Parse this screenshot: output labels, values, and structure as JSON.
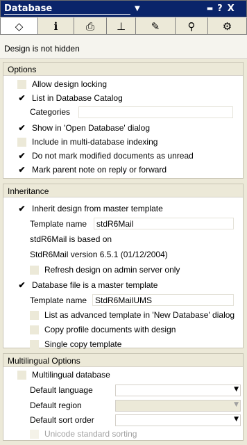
{
  "titlebar": {
    "title": "Database",
    "help": "?",
    "close": "X"
  },
  "tabs": [
    {
      "name": "basics",
      "icon": "basics-icon",
      "glyph": "⬡",
      "active": true
    },
    {
      "name": "info",
      "icon": "info-icon",
      "glyph": "i",
      "active": false
    },
    {
      "name": "print",
      "icon": "printer-icon",
      "glyph": "⎙",
      "active": false
    },
    {
      "name": "design",
      "icon": "design-icon",
      "glyph": "⊥",
      "active": false
    },
    {
      "name": "launch",
      "icon": "pen-icon",
      "glyph": "✎",
      "active": false
    },
    {
      "name": "fulltext",
      "icon": "magnifier-icon",
      "glyph": "⚲",
      "active": false
    },
    {
      "name": "advanced",
      "icon": "advanced-icon",
      "glyph": "⚙",
      "active": false
    }
  ],
  "status_text": "Design is not hidden",
  "options": {
    "header": "Options",
    "allow_locking": {
      "label": "Allow design locking",
      "checked": false
    },
    "list_catalog": {
      "label": "List in Database Catalog",
      "checked": true
    },
    "categories_label": "Categories",
    "categories_value": "",
    "show_open": {
      "label": "Show in 'Open Database' dialog",
      "checked": true
    },
    "multi_index": {
      "label": "Include in multi-database indexing",
      "checked": false
    },
    "no_unread": {
      "label": "Do not mark modified documents as unread",
      "checked": true
    },
    "mark_parent": {
      "label": "Mark parent note on reply or forward",
      "checked": true
    }
  },
  "inheritance": {
    "header": "Inheritance",
    "inherit": {
      "label": "Inherit design from master template",
      "checked": true
    },
    "template_name_label": "Template name",
    "template_name_value": "stdR6Mail",
    "based_on": "stdR6Mail is based on",
    "version": "StdR6Mail version 6.5.1 (01/12/2004)",
    "refresh": {
      "label": "Refresh design on admin server only",
      "checked": false
    },
    "master": {
      "label": "Database file is a master template",
      "checked": true
    },
    "master_name_label": "Template name",
    "master_name_value": "StdR6MailUMS",
    "list_advanced": {
      "label": "List as advanced template in 'New Database' dialog",
      "checked": false
    },
    "copy_profile": {
      "label": "Copy profile documents with design",
      "checked": false
    },
    "single_copy": {
      "label": "Single copy template",
      "checked": false
    }
  },
  "multilingual": {
    "header": "Multilingual Options",
    "multi_db": {
      "label": "Multilingual database",
      "checked": false
    },
    "default_language_label": "Default language",
    "default_language_value": "",
    "default_region_label": "Default region",
    "default_region_value": "",
    "default_sort_label": "Default sort order",
    "default_sort_value": "",
    "unicode": {
      "label": "Unicode standard sorting",
      "checked": false
    }
  },
  "colors": {
    "titlebar_bg": "#0a246a",
    "panel_bg": "#ece9d8",
    "section_bg": "#ffffff"
  }
}
